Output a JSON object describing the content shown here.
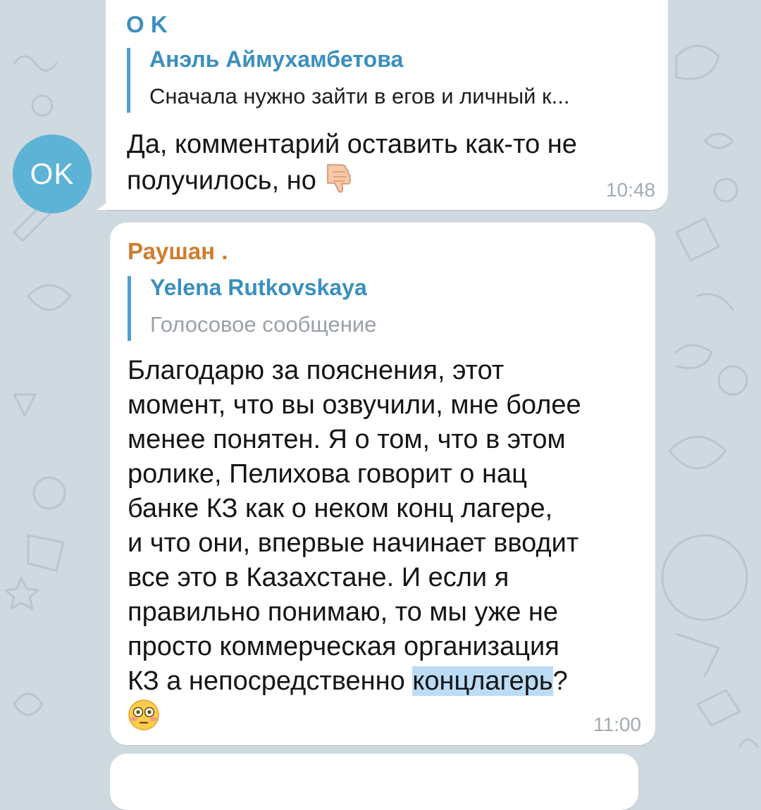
{
  "chat": {
    "messages": [
      {
        "avatar_initials": "OK",
        "sender": "O K",
        "reply": {
          "author": "Анэль Аймухамбетова",
          "text": "Сначала нужно зайти в егов и личный к..."
        },
        "text_lines": [
          "Да, комментарий оставить как-то не",
          "получилось, но"
        ],
        "emoji": "thumbs-down-icon",
        "time": "10:48"
      },
      {
        "sender": "Раушан .",
        "reply": {
          "author": "Yelena Rutkovskaya",
          "text": "Голосовое сообщение"
        },
        "text_lines": [
          "Благодарю за пояснения, этот",
          "момент, что вы озвучили, мне более",
          "менее понятен. Я о том, что в этом",
          "ролике, Пелихова говорит о нац",
          "банке КЗ  как о неком конц лагере,",
          "и что они, впервые начинает вводит",
          "все это в Казахстане. И если я",
          "правильно понимаю, то мы уже не",
          "просто коммерческая организация"
        ],
        "last_line_prefix": "КЗ а непосредственно ",
        "last_line_selected": "концлагерь",
        "last_line_suffix": "?",
        "emoji": "flushed-face-icon",
        "time": "11:00"
      }
    ]
  },
  "colors": {
    "background": "#cfd9e0",
    "avatar": "#5cb3d6",
    "sender1": "#3a8fbf",
    "sender2": "#d07c2e",
    "reply_bar": "#4f9fd1",
    "selection": "#bcdcf5"
  }
}
